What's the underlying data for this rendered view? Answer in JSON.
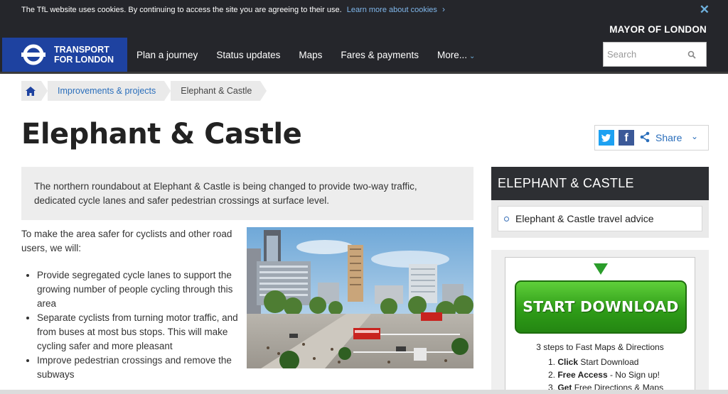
{
  "cookie": {
    "text": "The TfL website uses cookies. By continuing to access the site you are agreeing to their use.",
    "link": "Learn more about cookies",
    "chevron": "›",
    "close": "✕"
  },
  "header": {
    "mayor": "MAYOR OF LONDON",
    "logo_line1": "TRANSPORT",
    "logo_line2": "FOR LONDON",
    "nav": [
      "Plan a journey",
      "Status updates",
      "Maps",
      "Fares & payments",
      "More..."
    ],
    "more_chevron": "⌄",
    "search_placeholder": "Search"
  },
  "breadcrumb": {
    "items": [
      "Improvements & projects",
      "Elephant & Castle"
    ]
  },
  "page": {
    "title": "Elephant & Castle",
    "share_label": "Share",
    "share_chevron": "⌄",
    "intro": "The northern roundabout at Elephant & Castle is being changed to provide two-way traffic, dedicated cycle lanes and safer pedestrian crossings at surface level.",
    "lead": "To make the area safer for cyclists and other road users, we will:",
    "bullets": [
      "Provide segregated cycle lanes to support the growing number of people cycling through this area",
      "Separate cyclists from turning motor traffic, and from buses at most bus stops. This will make cycling safer and more pleasant",
      "Improve pedestrian crossings and remove the subways"
    ]
  },
  "sidebar": {
    "heading": "ELEPHANT & CASTLE",
    "link": "Elephant & Castle travel advice"
  },
  "ad": {
    "button": "START DOWNLOAD",
    "steps_title": "3 steps to Fast Maps & Directions",
    "step1_bold": "Click",
    "step1_rest": "Start Download",
    "step2_bold": "Free Access",
    "step2_rest": "- No Sign up!",
    "step3_bold": "Get",
    "step3_rest": "Free Directions & Maps"
  },
  "colors": {
    "topbar": "#25262b",
    "tfl_blue": "#1e42a0",
    "link_blue": "#2a6ebb",
    "ad_green": "#2f9d18"
  }
}
